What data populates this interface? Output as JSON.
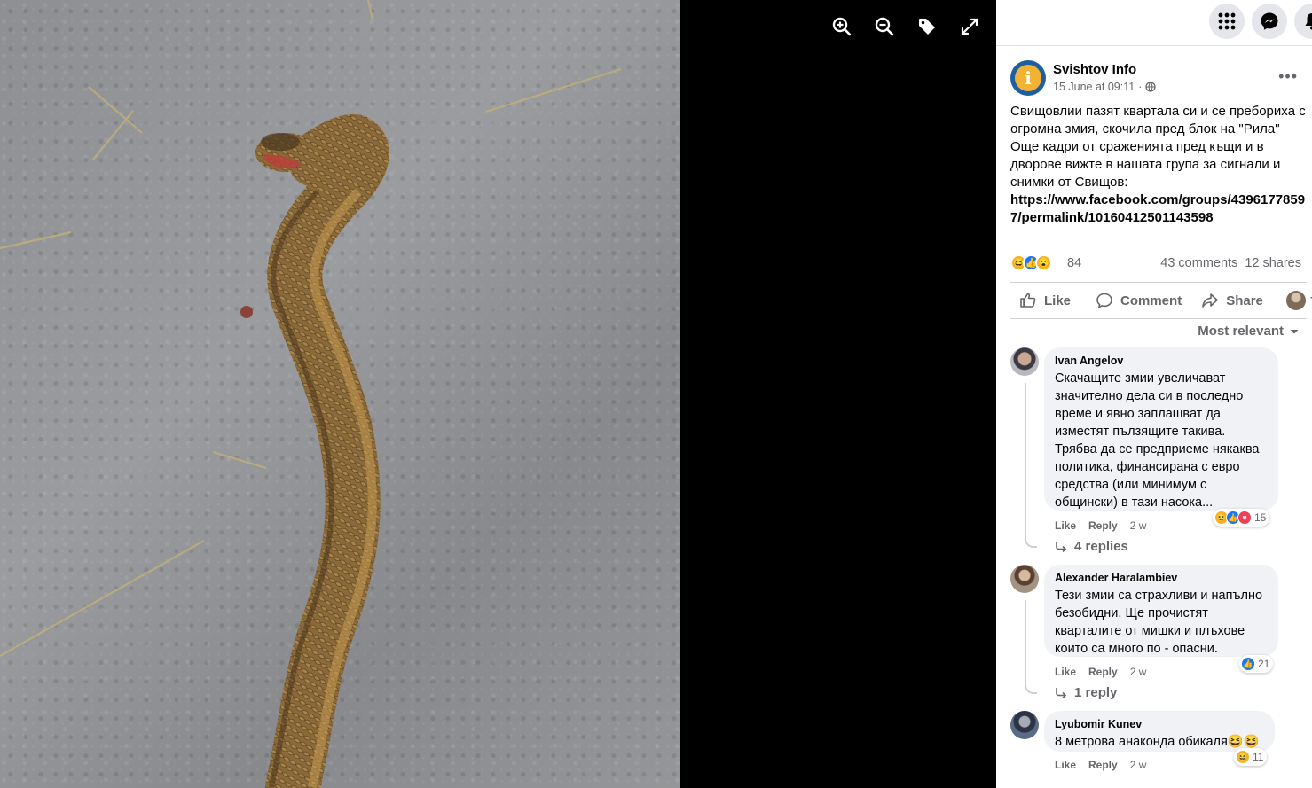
{
  "viewer": {
    "tools": [
      {
        "icon": "zoom-in-icon"
      },
      {
        "icon": "zoom-out-icon"
      },
      {
        "icon": "tag-icon"
      },
      {
        "icon": "fullscreen-icon"
      }
    ]
  },
  "topbar": {
    "buttons": [
      {
        "icon": "menu-grid-icon"
      },
      {
        "icon": "messenger-icon"
      },
      {
        "icon": "notifications-bell-icon"
      }
    ]
  },
  "post": {
    "page_name": "Svishtov Info",
    "timestamp": "15 June at 09:11",
    "privacy_icon": "globe-icon",
    "more_label": "•••",
    "text_lines": [
      "Свищовлии пазят квартала си и се преборихa с огромна змия, скочила пред блок на \"Рила\"",
      "Още кадри от сраженията пред къщи и в дворове вижте в нашата група за сигнали и снимки от Свищов:"
    ],
    "link": "https://www.facebook.com/groups/43961778597/permalink/10160412501143598",
    "reaction_count": "84",
    "comments_count": "43 comments",
    "shares_count": "12 shares",
    "actions": {
      "like": "Like",
      "comment": "Comment",
      "share": "Share"
    },
    "sort_label": "Most relevant"
  },
  "comments": [
    {
      "author": "Ivan Angelov",
      "text": "Скачащите змии увеличават значително дела си в последно време и явно заплашват да изместят пълзящите такива. Трябва да се предприеме някаква политика, финансирана с евро средства (или минимум с общински) в тази насока...",
      "like": "Like",
      "reply": "Reply",
      "time": "2 w",
      "reaction_count": "15",
      "replies": "4 replies"
    },
    {
      "author": "Alexander Haralambiev",
      "text": "Тези змии са страхливи и напълно безобидни. Ще прочистят кварталите от мишки и плъхове които са много по - опасни.",
      "like": "Like",
      "reply": "Reply",
      "time": "2 w",
      "reaction_count": "21",
      "replies": "1 reply"
    },
    {
      "author": "Lyubomir Kunev",
      "text": "8 метрова анаконда обикаля😆😆",
      "like": "Like",
      "reply": "Reply",
      "time": "2 w",
      "reaction_count": "11"
    }
  ],
  "colors": {
    "facebook_blue": "#1877f2",
    "love_red": "#f33e58",
    "haha_yellow": "#f7b125",
    "secondary_text": "#65676b"
  }
}
